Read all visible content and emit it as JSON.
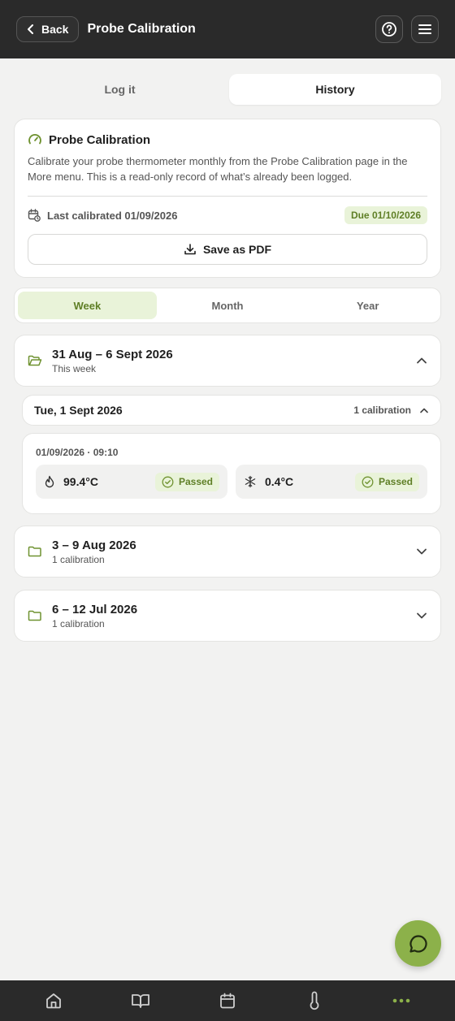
{
  "header": {
    "back_label": "Back",
    "title": "Probe Calibration",
    "help_icon": "help-circle-icon",
    "menu_icon": "hamburger-menu-icon"
  },
  "top_tabs": [
    {
      "label": "Log it",
      "active": false
    },
    {
      "label": "History",
      "active": true
    }
  ],
  "info": {
    "title": "Probe Calibration",
    "description": "Calibrate your probe thermometer monthly from the Probe Calibration page in the More menu. This is a read-only record of what’s already been logged.",
    "last_calibrated": "Last calibrated 01/09/2026",
    "due": "Due 01/10/2026",
    "pdf_label": "Save as PDF"
  },
  "period_tabs": [
    {
      "label": "Week",
      "active": true
    },
    {
      "label": "Month",
      "active": false
    },
    {
      "label": "Year",
      "active": false
    }
  ],
  "weeks": [
    {
      "title": "31 Aug – 6 Sept 2026",
      "sub": "This week",
      "expanded": true
    },
    {
      "title": "3 – 9 Aug 2026",
      "sub": "1 calibration",
      "expanded": false
    },
    {
      "title": "6 – 12 Jul 2026",
      "sub": "1 calibration",
      "expanded": false
    }
  ],
  "day": {
    "title": "Tue, 1 Sept 2026",
    "count": "1 calibration",
    "entry": {
      "time": "01/09/2026 · 09:10",
      "readings": [
        {
          "icon": "flame-icon",
          "value": "99.4°C",
          "status": "Passed"
        },
        {
          "icon": "snowflake-icon",
          "value": "0.4°C",
          "status": "Passed"
        }
      ]
    }
  },
  "colors": {
    "accent": "#8cb14a",
    "accent_text": "#5f7f26",
    "accent_bg": "#e9f3d9",
    "header_bg": "#2a2a2a"
  },
  "bottom_nav": [
    "home-icon",
    "book-icon",
    "calendar-icon",
    "thermometer-icon",
    "more-icon"
  ]
}
